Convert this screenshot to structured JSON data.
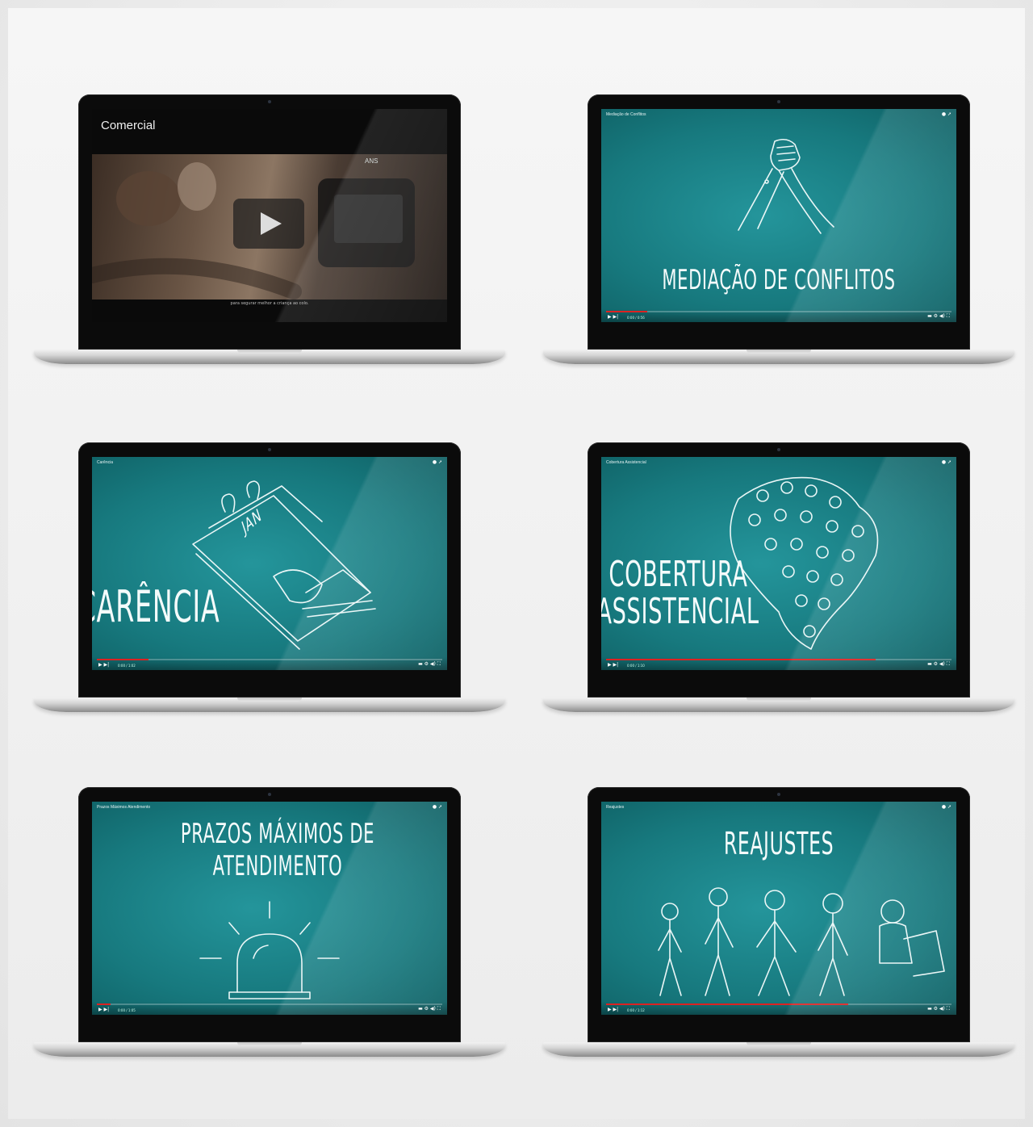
{
  "laptops": [
    {
      "id": "comercial",
      "screen_title": "Comercial",
      "caption": "para segurar melhor a criança ao colo.",
      "logo": "ANS",
      "controls": {
        "play": "▶"
      }
    },
    {
      "id": "mediacao",
      "yt_title": "Mediação de Conflitos",
      "headline": "MEDIAÇÃO DE CONFLITOS",
      "time": "0:00 / 0:56",
      "progress": 0.12
    },
    {
      "id": "carencia",
      "yt_title": "Carência",
      "headline": "CARÊNCIA",
      "calendar_text": "JAN",
      "time": "0:00 / 1:02",
      "progress": 0.15
    },
    {
      "id": "cobertura",
      "yt_title": "Cobertura Assistencial",
      "headline_line1": "COBERTURA",
      "headline_line2": "ASSISTENCIAL",
      "time": "0:00 / 1:10",
      "progress": 0.78
    },
    {
      "id": "prazos",
      "yt_title": "Prazos Máximos Atendimento",
      "headline_line1": "PRAZOS MÁXIMOS DE",
      "headline_line2": "ATENDIMENTO",
      "time": "0:00 / 1:05",
      "progress": 0.04
    },
    {
      "id": "reajustes",
      "yt_title": "Reajustes",
      "headline": "REAJUSTES",
      "time": "0:00 / 1:12",
      "progress": 0.7
    }
  ],
  "player": {
    "play_icon": "play-icon",
    "next_icon": "next-icon",
    "settings_icon": "gear-icon",
    "volume_icon": "volume-icon",
    "fullscreen_icon": "fullscreen-icon",
    "accent": "#dd2222",
    "teal": "#17797e"
  }
}
